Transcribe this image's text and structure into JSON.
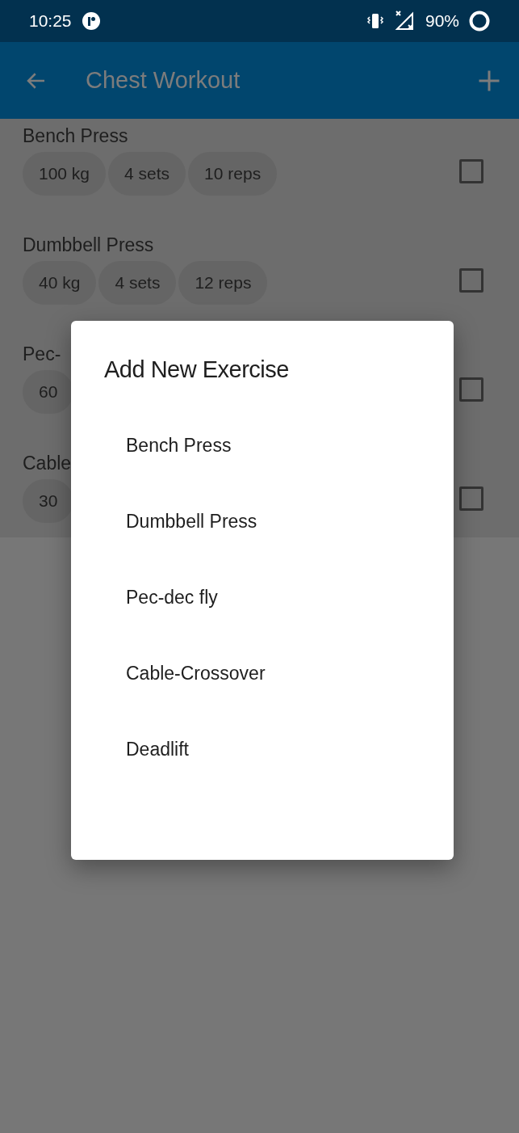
{
  "status_bar": {
    "time": "10:25",
    "battery": "90%"
  },
  "app_bar": {
    "title": "Chest Workout"
  },
  "exercises": [
    {
      "name": "Bench Press",
      "chips": [
        "100 kg",
        "4 sets",
        "10 reps"
      ],
      "checked": false
    },
    {
      "name": "Dumbbell Press",
      "chips": [
        "40 kg",
        "4 sets",
        "12 reps"
      ],
      "checked": false
    },
    {
      "name": "Pec-",
      "chips": [
        "60"
      ],
      "checked": false
    },
    {
      "name": "Cable",
      "chips": [
        "30"
      ],
      "checked": false
    }
  ],
  "dialog": {
    "title": "Add New Exercise",
    "options": [
      "Bench Press",
      "Dumbbell Press",
      "Pec-dec fly",
      "Cable-Crossover",
      "Deadlift"
    ]
  }
}
